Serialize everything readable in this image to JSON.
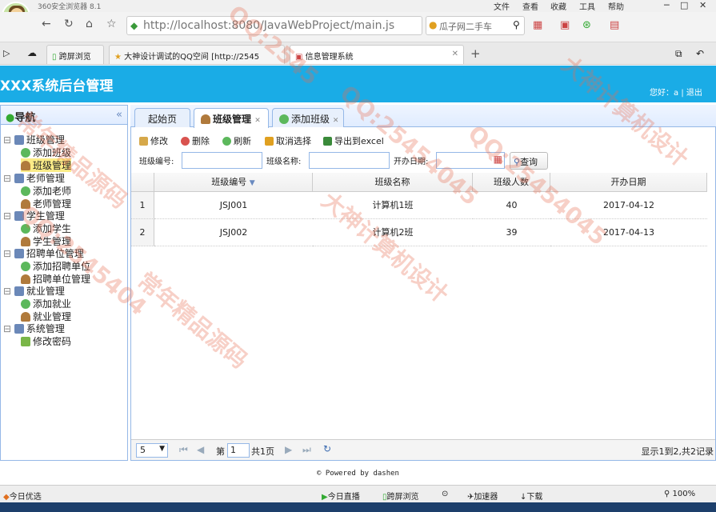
{
  "browser": {
    "app_name": "360安全浏览器 8.1",
    "menu": [
      "文件",
      "查看",
      "收藏",
      "工具",
      "帮助"
    ],
    "url": "http://localhost:8080/JavaWebProject/main.js",
    "search_text": "瓜子网二手车",
    "tabs": [
      {
        "label": "跨屏浏览"
      },
      {
        "label": "大神设计调试的QQ空间 [http://2545"
      },
      {
        "label": "信息管理系统"
      }
    ],
    "status_left": "今日优选",
    "status_items": [
      "今日直播",
      "跨屏浏览",
      "加速器",
      "下载",
      "100%"
    ]
  },
  "app": {
    "title": "XXX系统后台管理",
    "greeting": "您好：a",
    "logout": "退出",
    "footer": "Powered by dashen"
  },
  "sidebar": {
    "title": "导航",
    "groups": [
      {
        "label": "班级管理",
        "items": [
          "添加班级",
          "班级管理"
        ]
      },
      {
        "label": "老师管理",
        "items": [
          "添加老师",
          "老师管理"
        ]
      },
      {
        "label": "学生管理",
        "items": [
          "添加学生",
          "学生管理"
        ]
      },
      {
        "label": "招聘单位管理",
        "items": [
          "添加招聘单位",
          "招聘单位管理"
        ]
      },
      {
        "label": "就业管理",
        "items": [
          "添加就业",
          "就业管理"
        ]
      },
      {
        "label": "系统管理",
        "items": [
          "修改密码"
        ]
      }
    ]
  },
  "page_tabs": [
    "起始页",
    "班级管理",
    "添加班级"
  ],
  "toolbar": [
    "修改",
    "删除",
    "刷新",
    "取消选择",
    "导出到excel"
  ],
  "filters": {
    "class_no_label": "班级编号:",
    "class_name_label": "班级名称:",
    "start_date_label": "开办日期:",
    "query_label": "查询"
  },
  "grid": {
    "columns": [
      "班级编号",
      "班级名称",
      "班级人数",
      "开办日期"
    ],
    "rows": [
      {
        "index": "1",
        "no": "JSJ001",
        "name": "计算机1班",
        "count": "40",
        "date": "2017-04-12"
      },
      {
        "index": "2",
        "no": "JSJ002",
        "name": "计算机2班",
        "count": "39",
        "date": "2017-04-13"
      }
    ]
  },
  "pager": {
    "page_size": "5",
    "page_label": "第",
    "page_value": "1",
    "total_pages": "共1页",
    "summary": "显示1到2,共2记录"
  },
  "watermark": [
    "QQ:2545",
    "大神计算机设计",
    "常年精品源码",
    "QQ:25454045",
    "大神计算机设计",
    "常年精品源码",
    "QQ:25454045",
    "QQ:2545404"
  ]
}
